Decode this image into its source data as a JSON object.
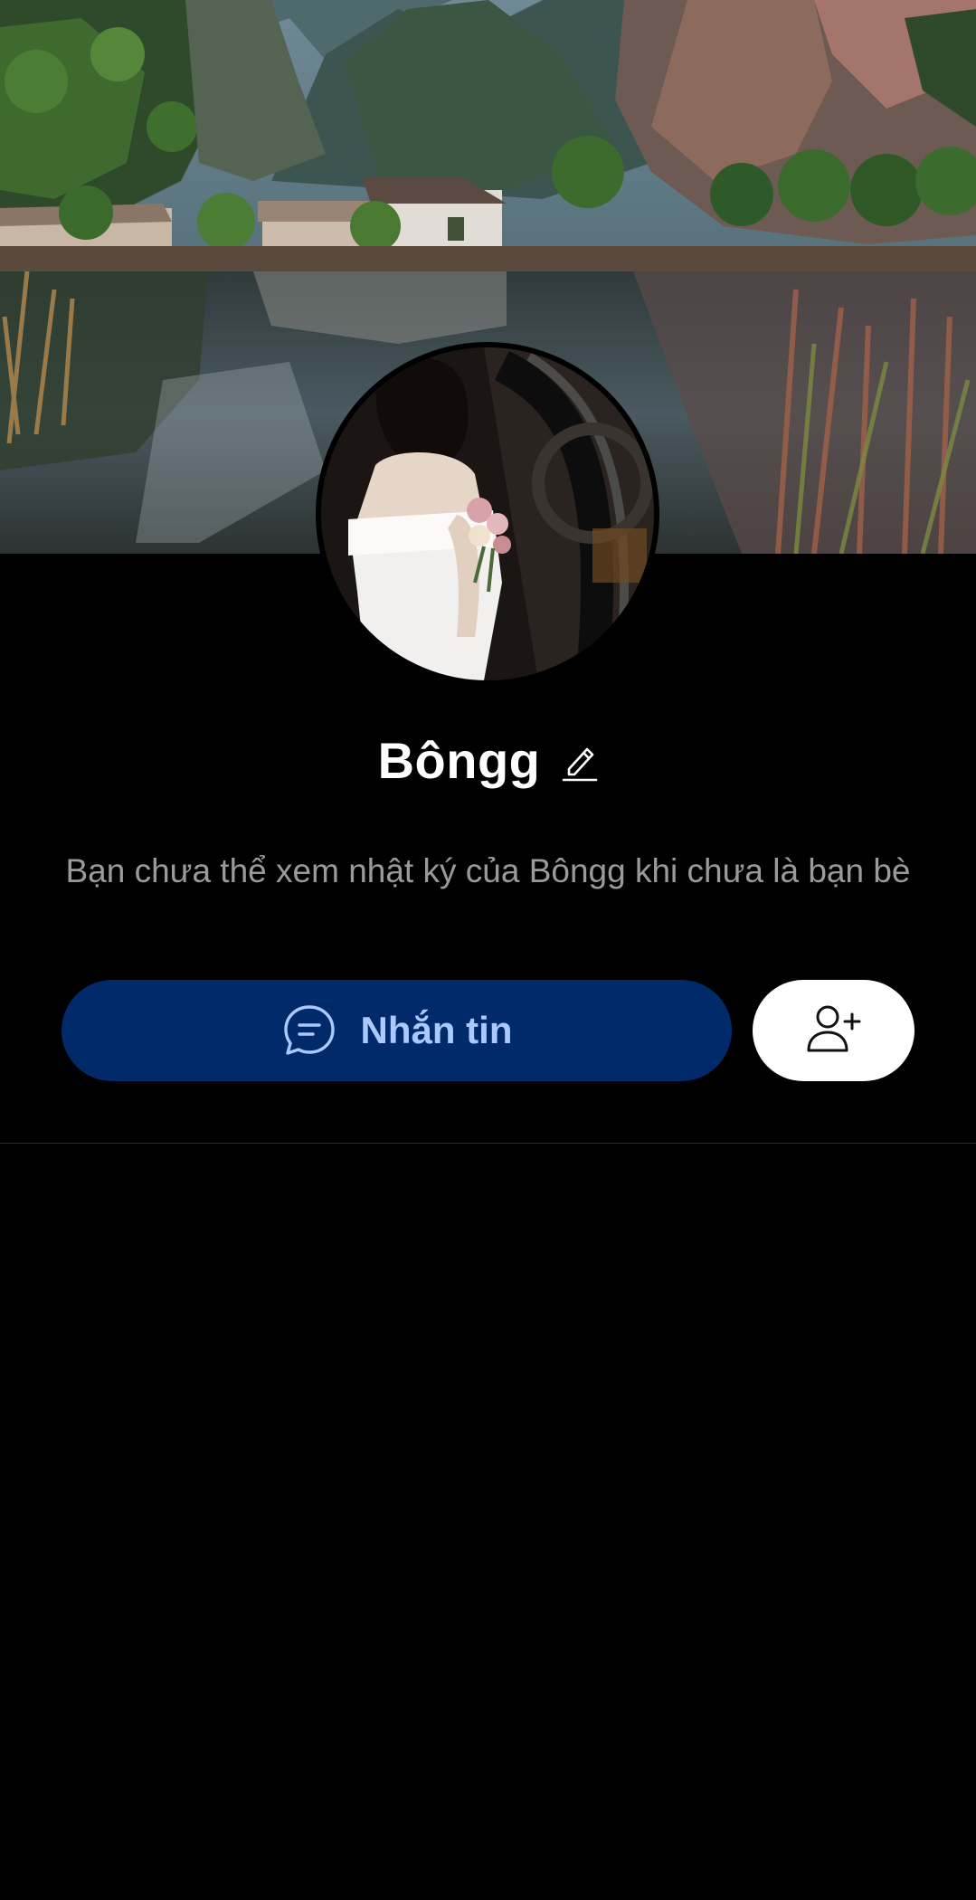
{
  "profile": {
    "name": "Bôngg",
    "notice": "Bạn chưa thể xem nhật ký của Bôngg khi chưa là bạn bè"
  },
  "actions": {
    "message_label": "Nhắn tin"
  },
  "icons": {
    "edit": "pencil-icon",
    "message": "chat-bubble-icon",
    "add_friend": "add-friend-icon"
  },
  "colors": {
    "background": "#000000",
    "message_button_bg": "#002a6a",
    "message_button_text": "#a9c9ff",
    "add_button_bg": "#ffffff",
    "notice_text": "#9a9a9a"
  }
}
